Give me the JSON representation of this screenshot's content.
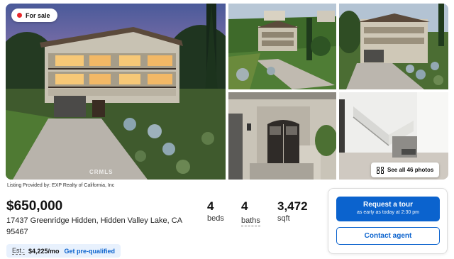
{
  "status_badge": {
    "label": "For sale",
    "dot_color": "#e8282b"
  },
  "gallery": {
    "watermark": "CRMLS",
    "see_all_label": "See all 46 photos",
    "photos": [
      {
        "name": "main-house-exterior",
        "subject": "house exterior at dusk"
      },
      {
        "name": "hillside-aerial",
        "subject": "hillside aerial view"
      },
      {
        "name": "front-driveway",
        "subject": "front facade and driveway"
      },
      {
        "name": "front-entry-door",
        "subject": "front entry door"
      },
      {
        "name": "interior-staircase",
        "subject": "interior staircase"
      }
    ]
  },
  "listing": {
    "provider": "Listing Provided by: EXP Realty of California, Inc",
    "price": "$650,000",
    "address_line1": "17437 Greenridge Hidden, Hidden Valley Lake, CA",
    "address_line2": "95467",
    "stats": {
      "beds": {
        "value": "4",
        "label": "beds"
      },
      "baths": {
        "value": "4",
        "label": "baths"
      },
      "sqft": {
        "value": "3,472",
        "label": "sqft"
      }
    },
    "estimate": {
      "label": "Est.:",
      "value": "$4,225/mo",
      "link": "Get pre-qualified"
    }
  },
  "contact": {
    "tour_title": "Request a tour",
    "tour_subtitle": "as early as today at 2:30 pm",
    "agent_label": "Contact agent"
  },
  "colors": {
    "accent": "#0b63ce",
    "estimate_bg": "#e8f1fd",
    "badge_dot": "#e8282b"
  }
}
